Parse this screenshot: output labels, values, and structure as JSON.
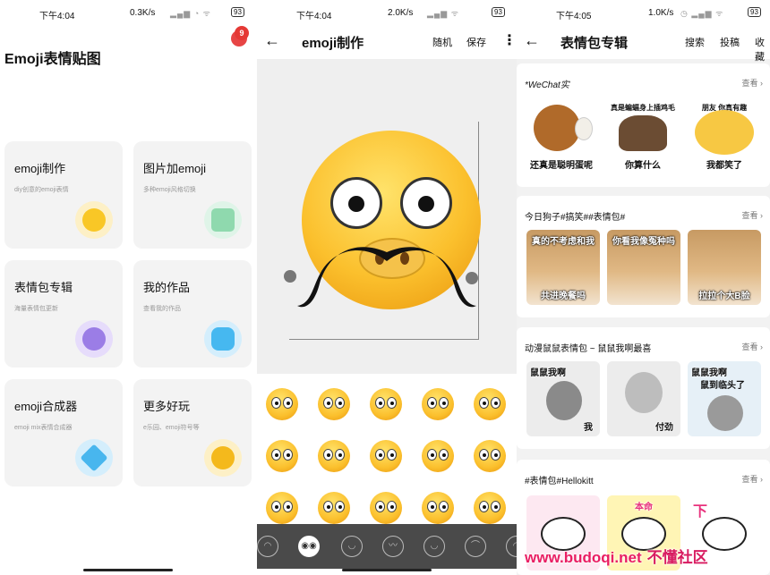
{
  "screens": [
    {
      "status": {
        "time": "下午4:04",
        "speed": "0.3K/s",
        "battery": "93"
      },
      "title": "Emoji表情贴图",
      "badge": "9",
      "cards": [
        {
          "title": "emoji制作",
          "subtitle": "diy创意的emoji表情",
          "icon": "smiley-icon",
          "color": "#fde9a8"
        },
        {
          "title": "图片加emoji",
          "subtitle": "多种emoji风格切换",
          "icon": "image-icon",
          "color": "#d9f3e4"
        },
        {
          "title": "表情包专辑",
          "subtitle": "海量表情包更新",
          "icon": "planet-icon",
          "color": "#e6dcfb"
        },
        {
          "title": "我的作品",
          "subtitle": "查看我的作品",
          "icon": "ghost-icon",
          "color": "#d4eefc"
        },
        {
          "title": "emoji合成器",
          "subtitle": "emoji mix表情合成器",
          "icon": "cube-icon",
          "color": "#d4eefc"
        },
        {
          "title": "更多好玩",
          "subtitle": "e乐园、emoji符号等",
          "icon": "goggles-icon",
          "color": "#fde9a8"
        }
      ]
    },
    {
      "status": {
        "time": "下午4:04",
        "speed": "2.0K/s",
        "battery": "93"
      },
      "title": "emoji制作",
      "actions": {
        "random": "随机",
        "save": "保存"
      }
    },
    {
      "status": {
        "time": "下午4:05",
        "speed": "1.0K/s",
        "battery": "93"
      },
      "title": "表情包专辑",
      "actions": {
        "search": "搜索",
        "submit": "投稿",
        "favorite": "收藏"
      },
      "albums": [
        {
          "title": "*WeChat实",
          "view": "查看",
          "stickers": [
            {
              "caption": "还真是聪明蛋呢",
              "top": ""
            },
            {
              "caption": "你算什么",
              "top": "真是蝙蝠身上插鸡毛"
            },
            {
              "caption": "我都笑了",
              "top": "朋友 你真有趣"
            }
          ]
        },
        {
          "title": "今日狗子#搞笑##表情包#",
          "view": "查看",
          "stickers": [
            {
              "caption": "共进晚餐吗",
              "top": "真的不考虑和我"
            },
            {
              "caption": "",
              "top": "你看我像冤种吗"
            },
            {
              "caption": "拉拉个大B脸",
              "top": ""
            }
          ]
        },
        {
          "title": "动漫鼠鼠表情包 ~ 鼠鼠我啊最喜",
          "view": "查看",
          "stickers": [
            {
              "caption": "我",
              "top": "鼠鼠我啊"
            },
            {
              "caption": "付劲",
              "top": ""
            },
            {
              "caption": "鼠到临头了",
              "top": "鼠鼠我啊"
            }
          ]
        },
        {
          "title": "#表情包#Hellokitt",
          "view": "查看",
          "stickers": [
            {
              "caption": "",
              "top": ""
            },
            {
              "caption": "",
              "top": "本命"
            },
            {
              "caption": "",
              "top": "下"
            }
          ]
        }
      ]
    }
  ],
  "watermark": {
    "site": "www.budoqi.net",
    "cn": "不懂社区"
  }
}
